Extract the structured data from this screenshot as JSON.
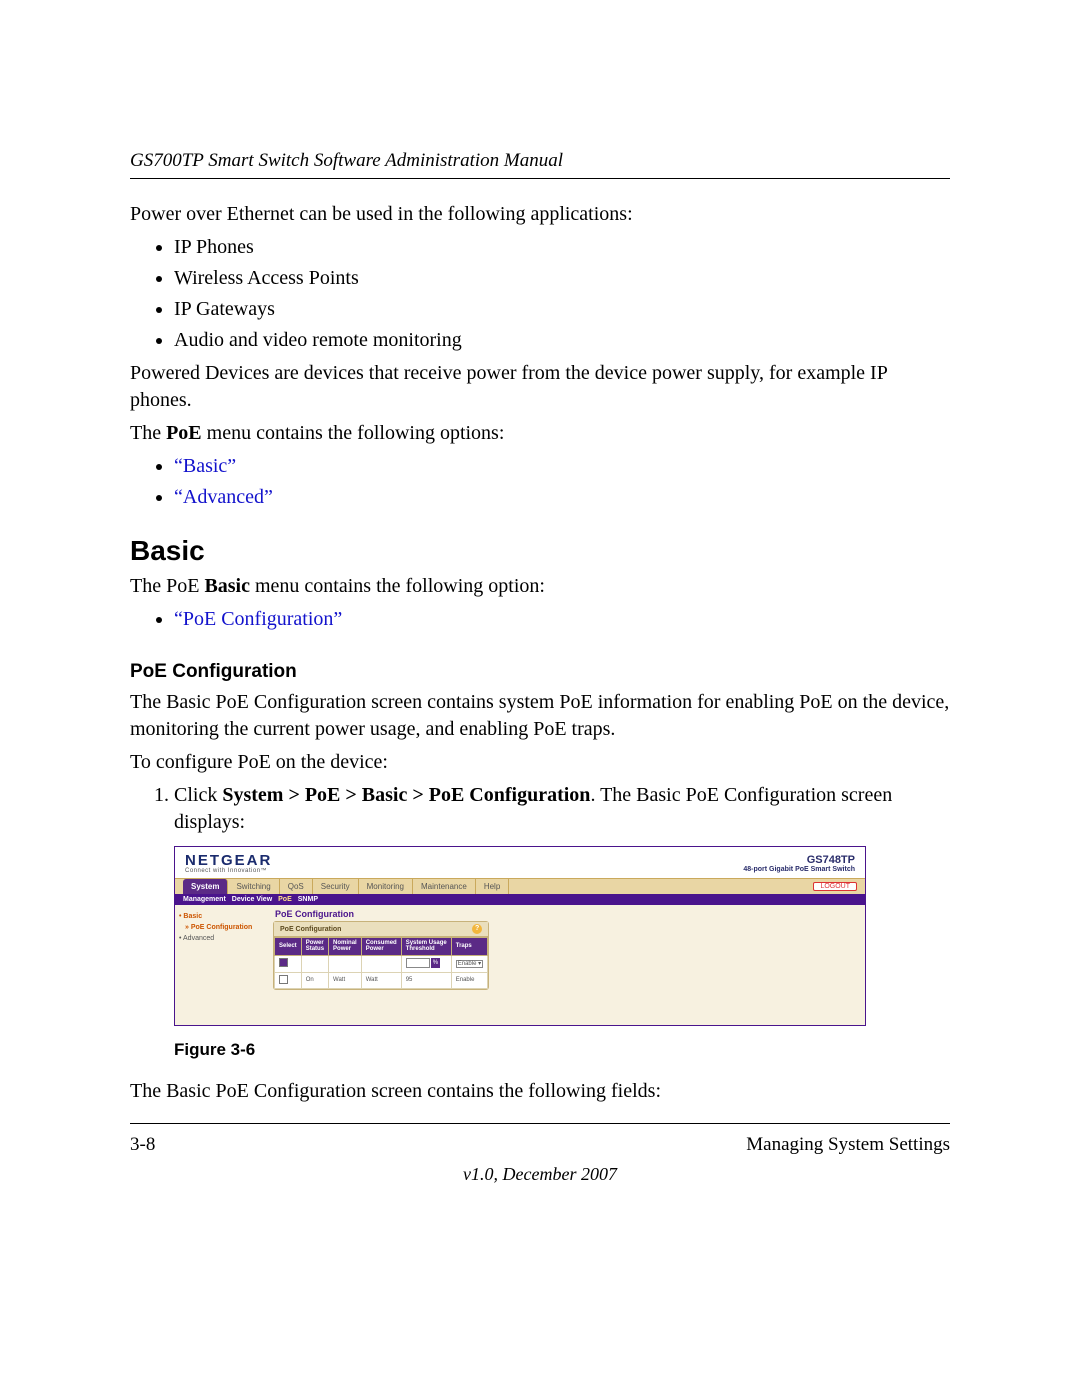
{
  "header": {
    "title": "GS700TP Smart Switch Software Administration Manual"
  },
  "intro": "Power over Ethernet can be used in the following applications:",
  "apps": [
    "IP Phones",
    "Wireless Access Points",
    "IP Gateways",
    "Audio and video remote monitoring"
  ],
  "powered_devices": "Powered Devices are devices that receive power from the device power supply, for example IP phones.",
  "poe_menu_lead": {
    "pre": "The ",
    "bold": "PoE",
    "post": " menu contains the following options:"
  },
  "poe_menu_links": [
    "“Basic”",
    "“Advanced”"
  ],
  "section_basic": {
    "heading": "Basic",
    "lead_pre": "The PoE ",
    "lead_bold": "Basic",
    "lead_post": " menu contains the following option:",
    "link": "“PoE Configuration”"
  },
  "poe_config": {
    "heading": "PoE Configuration",
    "desc": "The Basic PoE Configuration screen contains system PoE information for enabling PoE on the device, monitoring the current power usage, and enabling PoE traps.",
    "to": "To configure PoE on the device:",
    "step_num": "1.",
    "step_pre": "Click ",
    "step_bold": "System > PoE > Basic > PoE Configuration",
    "step_post": ". The Basic PoE Configuration screen displays:"
  },
  "figure": {
    "brand": "NETGEAR",
    "brand_tag": "Connect with Innovation™",
    "model": "GS748TP",
    "model_desc": "48-port Gigabit PoE Smart Switch",
    "tabs": [
      "System",
      "Switching",
      "QoS",
      "Security",
      "Monitoring",
      "Maintenance",
      "Help"
    ],
    "active_tab": "System",
    "logout": "LOGOUT",
    "subtabs": [
      "Management",
      "Device View",
      "PoE",
      "SNMP"
    ],
    "subtab_active": "PoE",
    "tree": {
      "group": "Basic",
      "current": "PoE Configuration",
      "other": "Advanced"
    },
    "panel_title": "PoE Configuration",
    "box_title": "PoE Configuration",
    "cols": [
      "Select",
      "Power Status",
      "Nominal Power",
      "Consumed Power",
      "System Usage Threshold",
      "Traps"
    ],
    "row1": {
      "status": "",
      "nominal": "",
      "consumed": "",
      "threshold": "",
      "traps_sel": "Enable ▾"
    },
    "row2": {
      "status": "On",
      "nominal": "Watt",
      "consumed": "Watt",
      "threshold": "95",
      "traps": "Enable"
    }
  },
  "figure_caption": "Figure 3-6",
  "after_figure": "The Basic PoE Configuration screen contains the following fields:",
  "footer": {
    "left": "3-8",
    "right": "Managing System Settings",
    "center": "v1.0, December 2007"
  }
}
